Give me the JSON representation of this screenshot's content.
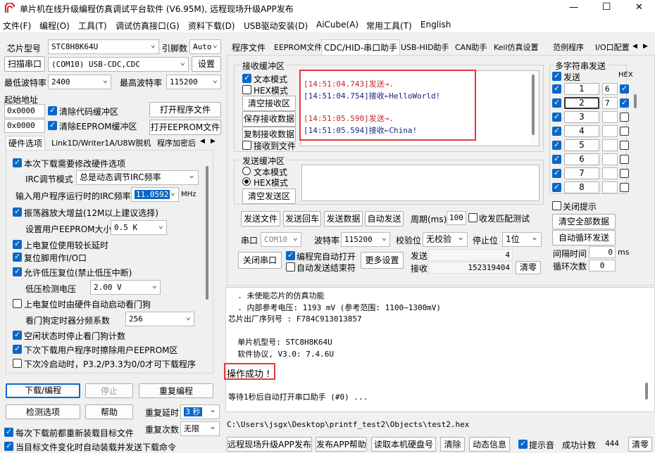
{
  "title": {
    "text": "单片机在线升级编程仿真调试平台软件 (V6.95M), 远程现场升级APP发布"
  },
  "window_buttons": {
    "minimize": "—",
    "maximize": "☐",
    "close": "✕"
  },
  "menu": [
    "文件(F)",
    "编程(O)",
    "工具(T)",
    "调试仿真接口(G)",
    "资料下载(D)",
    "USB驱动安装(D)",
    "AiCube(A)",
    "常用工具(T)",
    "English"
  ],
  "left": {
    "chip_label": "芯片型号",
    "chip_value": "STC8H8K64U",
    "pins_label": "引脚数",
    "pins_value": "Auto",
    "scan_port": "扫描串口",
    "port_value": "(COM10) USB-CDC,CDC",
    "settings": "设置",
    "min_baud_label": "最低波特率",
    "min_baud": "2400",
    "max_baud_label": "最高波特率",
    "max_baud": "115200",
    "start_addr_label": "起始地址",
    "addr1": "0x0000",
    "clear_code": "清除代码缓冲区",
    "open_prog": "打开程序文件",
    "addr2": "0x0000",
    "clear_eeprom": "清除EEPROM缓冲区",
    "open_eeprom": "打开EEPROM文件",
    "tabs": [
      "硬件选项",
      "Link1D/Writer1A/U8W脱机",
      "程序加密后"
    ],
    "opts": {
      "o1": "本次下载需要修改硬件选项",
      "irc_mode_label": "IRC调节模式",
      "irc_mode": "总是动态调节IRC频率",
      "irc_freq_label": "输入用户程序运行时的IRC频率",
      "irc_freq": "11.0592",
      "mhz": "MHz",
      "o2": "振荡器放大增益(12M以上建议选择)",
      "eeprom_size_label": "设置用户EEPROM大小",
      "eeprom_size": "0.5 K",
      "o3": "上电复位使用较长延时",
      "o4": "复位脚用作I/O口",
      "o5": "允许低压复位(禁止低压中断)",
      "lvd_label": "低压检测电压",
      "lvd": "2.00 V",
      "o6": "上电复位时由硬件自动启动看门狗",
      "wdt_label": "看门狗定时器分频系数",
      "wdt": "256",
      "o7": "空闲状态时停止看门狗计数",
      "o8": "下次下载用户程序时擦除用户EEPROM区",
      "o9": "下次冷启动时，P3.2/P3.3为0/0才可下载程序"
    },
    "download": "下载/编程",
    "stop": "停止",
    "reprogram": "重复编程",
    "detect": "检测选项",
    "help": "帮助",
    "retry_delay_label": "重复延时",
    "retry_delay": "3 秒",
    "retry_count_label": "重复次数",
    "retry_count": "无限",
    "reload": "每次下载前都重新装载目标文件",
    "auto_load": "当目标文件变化时自动装载并发送下载命令"
  },
  "right_tabs": [
    "程序文件",
    "EEPROM文件",
    "CDC/HID-串口助手",
    "USB-HID助手",
    "CAN助手",
    "Keil仿真设置",
    "范例程序",
    "I/O口配置"
  ],
  "recv": {
    "title": "接收缓冲区",
    "text_mode": "文本模式",
    "hex_mode": "HEX模式",
    "clear": "清空接收区",
    "save": "保存接收数据",
    "copy": "复制接收数据",
    "to_file": "接收到文件",
    "lines": [
      {
        "ts": "[14:51:04.743]",
        "dir": "发送→",
        "msg": "."
      },
      {
        "ts": "[14:51:04.754]",
        "dir": "接收←",
        "msg": "HelloWorld!"
      },
      {
        "ts": "[14:51:05.590]",
        "dir": "发送→",
        "msg": "."
      },
      {
        "ts": "[14:51:05.594]",
        "dir": "接收←",
        "msg": "China!"
      }
    ]
  },
  "send": {
    "title": "发送缓冲区",
    "text_mode": "文本模式",
    "hex_mode": "HEX模式",
    "clear": "清空发送区"
  },
  "send_row": {
    "file": "发送文件",
    "loop": "发送回车",
    "data": "发送数据",
    "auto": "自动发送",
    "period_label": "周期(ms)",
    "period": "100",
    "match": "收发匹配测试"
  },
  "port_row": {
    "port_label": "串口",
    "port": "COM10",
    "baud_label": "波特率",
    "baud": "115200",
    "parity_label": "校验位",
    "parity": "无校验",
    "stop_label": "停止位",
    "stop": "1位"
  },
  "close_port": "关闭串口",
  "open_after_prog": "编程完自动打开",
  "stop_on_auto": "自动发送结束符",
  "more": "更多设置",
  "counters": {
    "send_label": "发送",
    "send": "4",
    "recv_label": "接收",
    "recv": "152319404",
    "clear": "清零"
  },
  "multi": {
    "title": "多字符串发送",
    "send_col": "发送",
    "hex_col": "HEX",
    "rows": [
      {
        "n": "1",
        "v": "6"
      },
      {
        "n": "2",
        "v": "7"
      },
      {
        "n": "3",
        "v": ""
      },
      {
        "n": "4",
        "v": ""
      },
      {
        "n": "5",
        "v": ""
      },
      {
        "n": "6",
        "v": ""
      },
      {
        "n": "7",
        "v": ""
      },
      {
        "n": "8",
        "v": ""
      }
    ],
    "close_hint": "关闭提示",
    "clear_all": "清空全部数据",
    "auto_loop": "自动循环发送",
    "interval_label": "间隔时间",
    "interval": "0",
    "ms": "ms",
    "loops_label": "循环次数",
    "loops": "0"
  },
  "log": {
    "lines": [
      "  . 未使能芯片的仿真功能",
      "  . 内部参考电压: 1193 mV (参考范围: 1100~1300mV)",
      "芯片出厂序列号 : F784C913013857",
      "",
      "  单片机型号: STC8H8K64U",
      "  软件协议, V3.0: 7.4.6U"
    ],
    "success": "操作成功 !",
    "wait": "等待1秒后自动打开串口助手 (#0) ..."
  },
  "path": "C:\\Users\\jsgx\\Desktop\\printf_test2\\Objects\\test2.hex",
  "bottom": {
    "remote": "远程现场升级APP发布",
    "publish_help": "发布APP帮助",
    "read_disk": "读取本机硬盘号",
    "clear": "清除",
    "anim": "动态信息",
    "prompt": "提示音",
    "count_label": "成功计数",
    "count": "444",
    "reset": "清零"
  }
}
